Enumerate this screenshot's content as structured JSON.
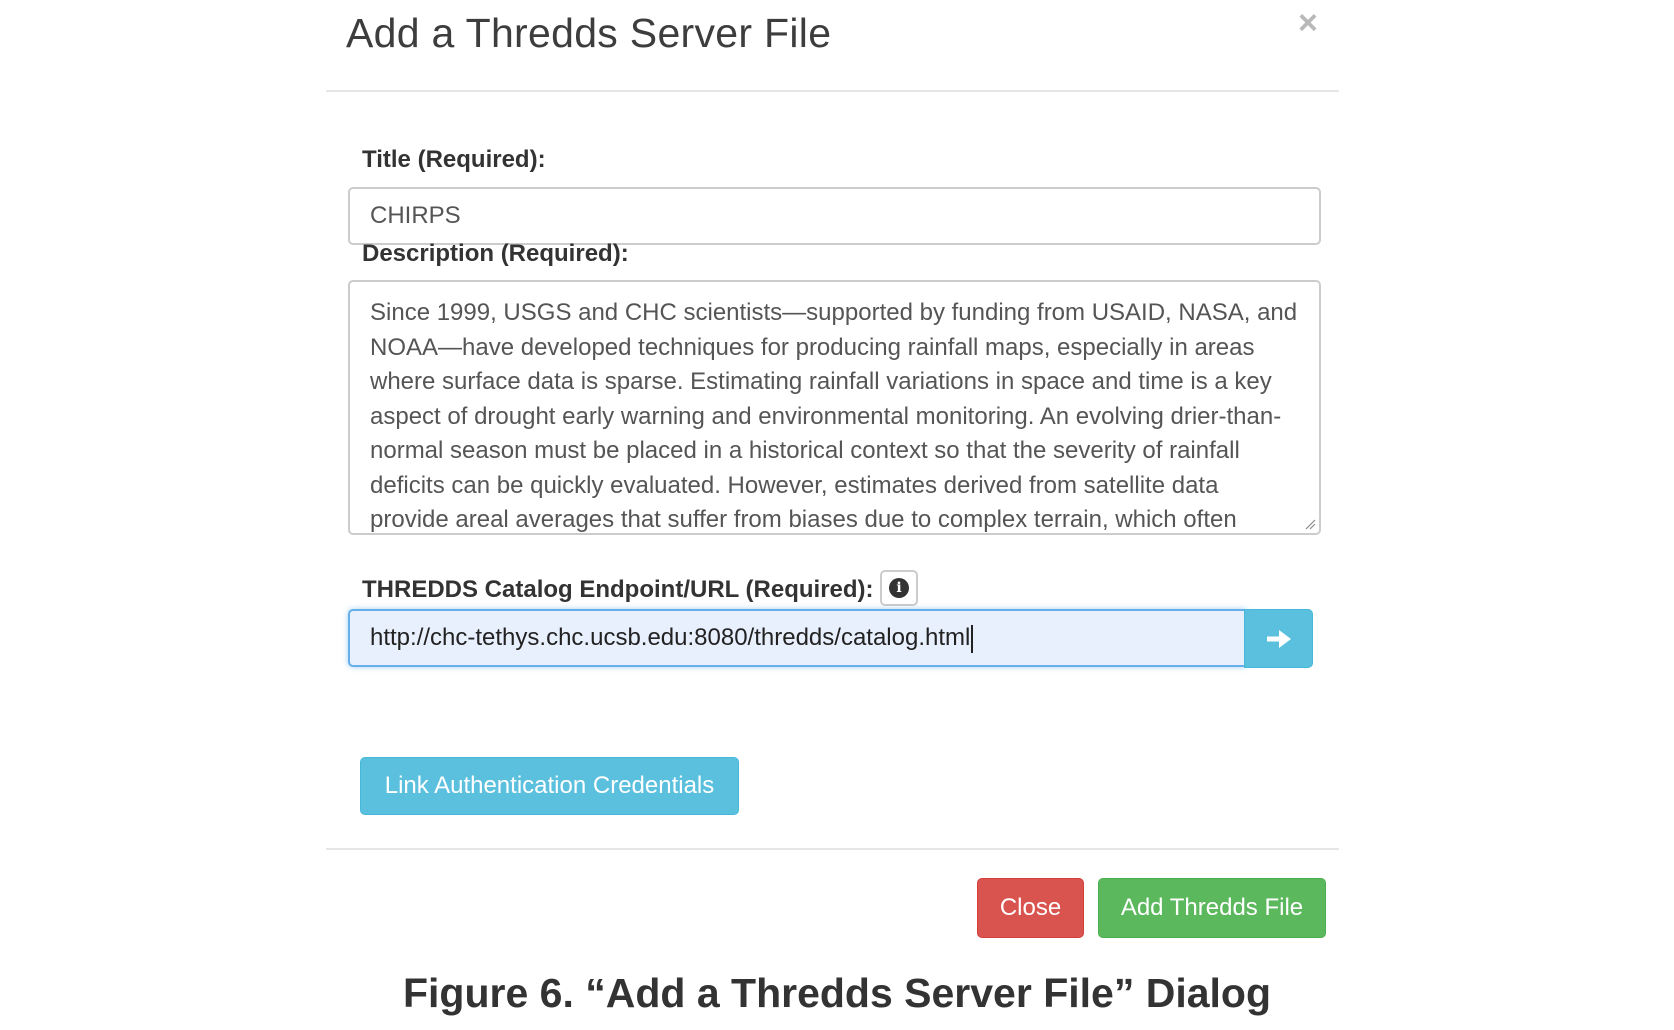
{
  "dialog": {
    "title": "Add a Thredds Server File",
    "close_glyph": "×"
  },
  "form": {
    "title_label": "Title (Required):",
    "title_value": "CHIRPS",
    "description_label": "Description (Required):",
    "description_value": "Since 1999, USGS and CHC scientists—supported by funding from USAID, NASA, and NOAA—have developed techniques for producing rainfall maps, especially in areas where surface data is sparse. Estimating rainfall variations in space and time is a key aspect of drought early warning and environmental monitoring. An evolving drier-than-normal season must be placed in a historical context so that the severity of rainfall deficits can be quickly evaluated. However, estimates derived from satellite data provide areal averages that suffer from biases due to complex terrain, which often",
    "url_label": "THREDDS Catalog Endpoint/URL (Required):",
    "url_value": "http://chc-tethys.chc.ucsb.edu:8080/thredds/catalog.html",
    "info_icon": "info-circle-icon",
    "go_icon": "arrow-right-icon"
  },
  "buttons": {
    "link_credentials": "Link Authentication Credentials",
    "close": "Close",
    "add": "Add Thredds File"
  },
  "colors": {
    "info": "#5bc0de",
    "danger": "#d9534f",
    "success": "#5cb85c",
    "focus_border": "#66afe9"
  },
  "caption": "Figure 6. “Add a Thredds Server File” Dialog"
}
